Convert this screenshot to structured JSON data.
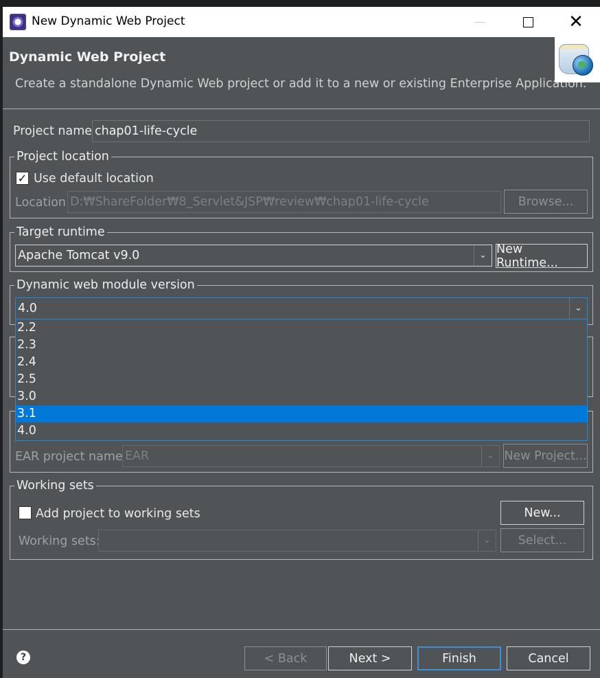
{
  "window": {
    "title": "New Dynamic Web Project",
    "controls": {
      "minimize": "–",
      "maximize": "□",
      "close": "✕"
    }
  },
  "header": {
    "title": "Dynamic Web Project",
    "description": "Create a standalone Dynamic Web project or add it to a new or existing Enterprise Application.",
    "banner_icon": "web-project-jar-globe-icon"
  },
  "project": {
    "name_label": "Project name:",
    "name_value": "chap01-life-cycle"
  },
  "location": {
    "legend": "Project location",
    "use_default_label": "Use default location",
    "use_default_checked": "✓",
    "location_label": "Location:",
    "location_value": "D:₩ShareFolder₩8_Servlet&JSP₩review₩chap01-life-cycle",
    "browse_label": "Browse..."
  },
  "runtime": {
    "legend": "Target runtime",
    "selected": "Apache Tomcat v9.0",
    "new_runtime_label": "New Runtime..."
  },
  "module_version": {
    "legend": "Dynamic web module version",
    "selected": "4.0",
    "options": [
      "2.2",
      "2.3",
      "2.4",
      "2.5",
      "3.0",
      "3.1",
      "4.0"
    ],
    "highlighted": "3.1"
  },
  "ear": {
    "ear_label": "EAR project name:",
    "ear_value": "EAR",
    "new_project_label": "New Project..."
  },
  "working_sets": {
    "legend": "Working sets",
    "add_label": "Add project to working sets",
    "new_label": "New...",
    "sets_label": "Working sets:",
    "sets_value": "",
    "select_label": "Select..."
  },
  "footer": {
    "help": "?",
    "back_label": "< Back",
    "next_label": "Next >",
    "finish_label": "Finish",
    "cancel_label": "Cancel"
  },
  "colors": {
    "dialog_bg": "#505456",
    "selection": "#0078d7",
    "focus_border": "#3d8fd6"
  }
}
